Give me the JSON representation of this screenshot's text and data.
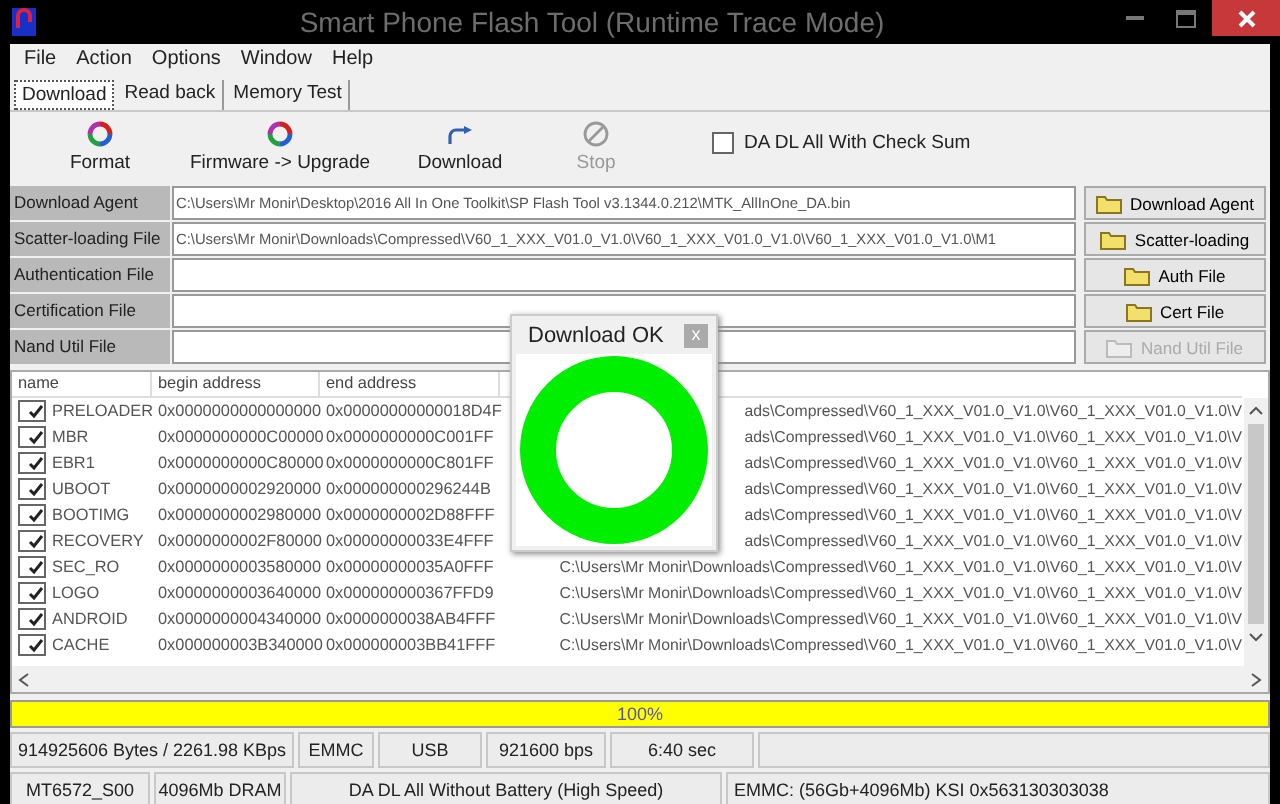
{
  "window": {
    "title": "Smart Phone Flash Tool (Runtime Trace Mode)"
  },
  "menu": [
    "File",
    "Action",
    "Options",
    "Window",
    "Help"
  ],
  "tabs": [
    {
      "label": "Download",
      "selected": true
    },
    {
      "label": "Read back",
      "selected": false
    },
    {
      "label": "Memory Test",
      "selected": false
    }
  ],
  "toolbar": [
    {
      "label": "Format",
      "kind": "format",
      "disabled": false
    },
    {
      "label": "Firmware -> Upgrade",
      "kind": "firmware",
      "disabled": false
    },
    {
      "label": "Download",
      "kind": "download",
      "disabled": false
    },
    {
      "label": "Stop",
      "kind": "stop",
      "disabled": true
    }
  ],
  "checksum": {
    "label": "DA DL All With Check Sum",
    "checked": false
  },
  "files": [
    {
      "label": "Download Agent",
      "value": "C:\\Users\\Mr Monir\\Desktop\\2016 All In One Toolkit\\SP Flash Tool v3.1344.0.212\\MTK_AllInOne_DA.bin",
      "button": "Download Agent",
      "disabled": false
    },
    {
      "label": "Scatter-loading File",
      "value": "C:\\Users\\Mr Monir\\Downloads\\Compressed\\V60_1_XXX_V01.0_V1.0\\V60_1_XXX_V01.0_V1.0\\V60_1_XXX_V01.0_V1.0\\M1",
      "button": "Scatter-loading",
      "disabled": false
    },
    {
      "label": "Authentication File",
      "button": "Auth File",
      "disabled": false
    },
    {
      "label": "Certification File",
      "button": "Cert File",
      "disabled": false
    },
    {
      "label": "Nand Util File",
      "button": "Nand Util File",
      "disabled": true
    }
  ],
  "table": {
    "columns": [
      "name",
      "begin address",
      "end address"
    ],
    "rows": [
      {
        "name": "PRELOADER",
        "checked": true,
        "begin": "0x0000000000000000",
        "end": "0x00000000000018D4F",
        "location": "ads\\Compressed\\V60_1_XXX_V01.0_V1.0\\V60_1_XXX_V01.0_V1.0\\V"
      },
      {
        "name": "MBR",
        "checked": true,
        "begin": "0x0000000000C00000",
        "end": "0x0000000000C001FF",
        "location": "ads\\Compressed\\V60_1_XXX_V01.0_V1.0\\V60_1_XXX_V01.0_V1.0\\V"
      },
      {
        "name": "EBR1",
        "checked": true,
        "begin": "0x0000000000C80000",
        "end": "0x0000000000C801FF",
        "location": "ads\\Compressed\\V60_1_XXX_V01.0_V1.0\\V60_1_XXX_V01.0_V1.0\\V"
      },
      {
        "name": "UBOOT",
        "checked": true,
        "begin": "0x0000000002920000",
        "end": "0x000000000296244B",
        "location": "ads\\Compressed\\V60_1_XXX_V01.0_V1.0\\V60_1_XXX_V01.0_V1.0\\V"
      },
      {
        "name": "BOOTIMG",
        "checked": true,
        "begin": "0x0000000002980000",
        "end": "0x0000000002D88FFF",
        "location": "ads\\Compressed\\V60_1_XXX_V01.0_V1.0\\V60_1_XXX_V01.0_V1.0\\V"
      },
      {
        "name": "RECOVERY",
        "checked": true,
        "begin": "0x0000000002F80000",
        "end": "0x00000000033E4FFF",
        "location": "ads\\Compressed\\V60_1_XXX_V01.0_V1.0\\V60_1_XXX_V01.0_V1.0\\V"
      },
      {
        "name": "SEC_RO",
        "checked": true,
        "begin": "0x0000000003580000",
        "end": "0x00000000035A0FFF",
        "location": "C:\\Users\\Mr Monir\\Downloads\\Compressed\\V60_1_XXX_V01.0_V1.0\\V60_1_XXX_V01.0_V1.0\\V"
      },
      {
        "name": "LOGO",
        "checked": true,
        "begin": "0x0000000003640000",
        "end": "0x000000000367FFD9",
        "location": "C:\\Users\\Mr Monir\\Downloads\\Compressed\\V60_1_XXX_V01.0_V1.0\\V60_1_XXX_V01.0_V1.0\\V"
      },
      {
        "name": "ANDROID",
        "checked": true,
        "begin": "0x0000000004340000",
        "end": "0x0000000038AB4FFF",
        "location": "C:\\Users\\Mr Monir\\Downloads\\Compressed\\V60_1_XXX_V01.0_V1.0\\V60_1_XXX_V01.0_V1.0\\V"
      },
      {
        "name": "CACHE",
        "checked": true,
        "begin": "0x000000003B340000",
        "end": "0x000000003BB41FFF",
        "location": "C:\\Users\\Mr Monir\\Downloads\\Compressed\\V60_1_XXX_V01.0_V1.0\\V60_1_XXX_V01.0_V1.0\\V"
      }
    ]
  },
  "progress": {
    "level": 1,
    "label": "100%"
  },
  "status_bar": [
    [
      "914925606 Bytes / 2261.98 KBps",
      "EMMC",
      "USB",
      "921600 bps",
      "6:40 sec"
    ],
    [
      "MT6572_S00",
      "4096Mb DRAM",
      "DA DL All Without Battery (High Speed)",
      "EMMC: (56Gb+4096Mb) KSI 0x563130303038"
    ]
  ],
  "dialog": {
    "title": "Download OK",
    "close": "x"
  }
}
